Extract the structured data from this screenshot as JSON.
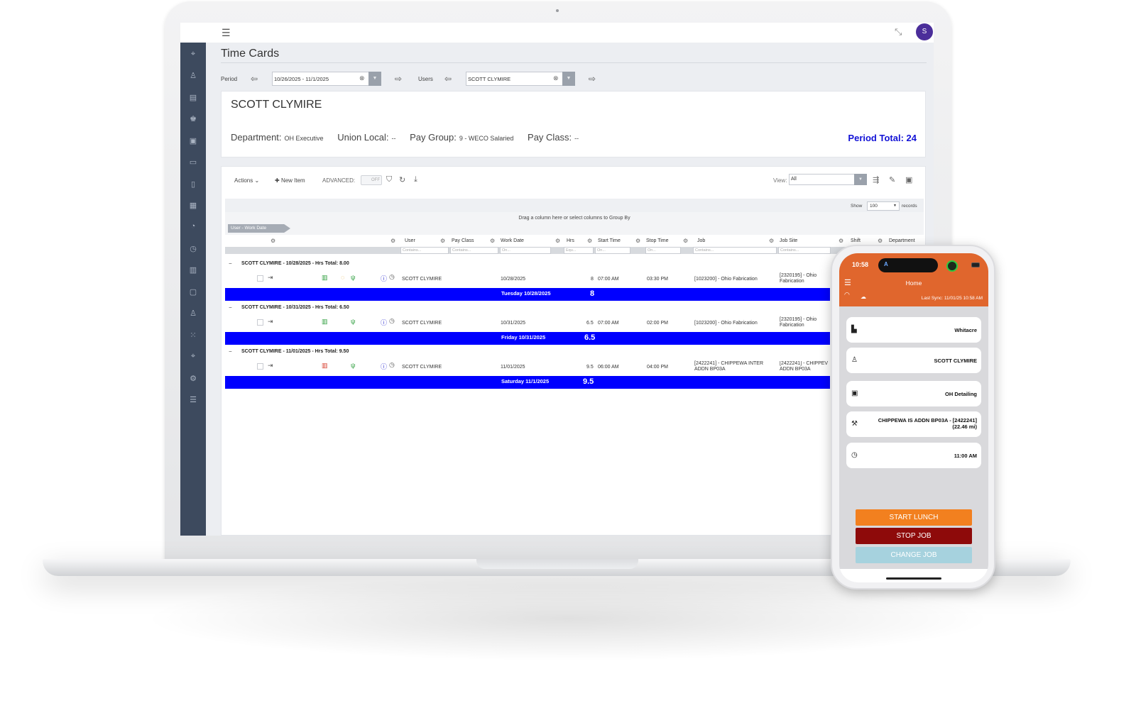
{
  "page": {
    "title": "Time Cards"
  },
  "topbar": {
    "avatar_initial": "S"
  },
  "filters": {
    "period_label": "Period",
    "period_value": "10/26/2025 - 11/1/2025",
    "users_label": "Users",
    "users_value": "SCOTT CLYMIRE"
  },
  "employee": {
    "name": "SCOTT CLYMIRE",
    "department_label": "Department:",
    "department_value": "OH Executive",
    "union_label": "Union Local:",
    "union_value": "--",
    "pay_group_label": "Pay Group:",
    "pay_group_value": "9 - WECO Salaried",
    "pay_class_label": "Pay Class:",
    "pay_class_value": "--",
    "period_total_label": "Period Total:",
    "period_total_value": "24"
  },
  "toolbar": {
    "actions_label": "Actions",
    "new_item_label": "New Item",
    "advanced_label": "ADVANCED:",
    "toggle_off": "OFF",
    "view_label": "View:",
    "view_value": "All"
  },
  "grid": {
    "show_label": "Show",
    "show_value": "100",
    "records_label": "records",
    "group_hint": "Drag a column here or select columns to Group By",
    "group_chip": "User - Work Date",
    "columns": [
      "User",
      "Pay Class",
      "Work Date",
      "Hrs",
      "Start Time",
      "Stop Time",
      "Job",
      "Job Site",
      "Shift",
      "Department"
    ],
    "filter_placeholders": {
      "contains": "Contains...",
      "on": "On...",
      "equ": "Equ..."
    },
    "groups": [
      {
        "header": "SCOTT CLYMIRE - 10/28/2025 - Hrs Total: 8.00",
        "row": {
          "user": "SCOTT CLYMIRE",
          "work_date": "10/28/2025",
          "hrs": "8",
          "start": "07:00 AM",
          "stop": "03:30 PM",
          "job": "[1023200] - Ohio Fabrication",
          "job_site": "[2320195] - Ohio Fabrication"
        },
        "total_date": "Tuesday 10/28/2025",
        "total_hrs": "8"
      },
      {
        "header": "SCOTT CLYMIRE - 10/31/2025 - Hrs Total: 6.50",
        "row": {
          "user": "SCOTT CLYMIRE",
          "work_date": "10/31/2025",
          "hrs": "6.5",
          "start": "07:00 AM",
          "stop": "02:00 PM",
          "job": "[1023200] - Ohio Fabrication",
          "job_site": "[2320195] - Ohio Fabrication"
        },
        "total_date": "Friday 10/31/2025",
        "total_hrs": "6.5"
      },
      {
        "header": "SCOTT CLYMIRE - 11/01/2025 - Hrs Total: 9.50",
        "row": {
          "user": "SCOTT CLYMIRE",
          "work_date": "11/01/2025",
          "hrs": "9.5",
          "start": "06:00 AM",
          "stop": "04:00 PM",
          "job": "[2422241] - CHIPPEWA INTER ADDN BP03A",
          "job_site": "[2422241] - CHIPPEV ADDN BP03A"
        },
        "total_date": "Saturday 11/1/2025",
        "total_hrs": "9.5"
      }
    ]
  },
  "phone": {
    "time": "10:58",
    "island_glyph": "A",
    "title": "Home",
    "last_sync": "Last Sync: 11/01/25 10:58 AM",
    "cards": [
      {
        "icon": "building-icon",
        "text": "Whitacre"
      },
      {
        "icon": "user-icon",
        "text": "SCOTT CLYMIRE"
      },
      {
        "icon": "briefcase-icon",
        "text": "OH Detailing"
      },
      {
        "icon": "tools-icon",
        "text_line1": "CHIPPEWA IS ADDN BP03A - [2422241]",
        "text_line2": "(22.46 mi)"
      },
      {
        "icon": "clock-icon",
        "text": "11:00 AM"
      }
    ],
    "start_lunch": "START LUNCH",
    "stop_job": "STOP JOB",
    "change_job": "CHANGE JOB",
    "colors": {
      "header": "#e0662d",
      "start_lunch": "#f2801f",
      "stop_job": "#8e0a0a",
      "change_job": "#a6d2de"
    }
  },
  "colors": {
    "sidebar": "#3d4a5e",
    "total_bar": "#0000ff",
    "period_total": "#1212d6",
    "avatar": "#4b2e9a"
  }
}
